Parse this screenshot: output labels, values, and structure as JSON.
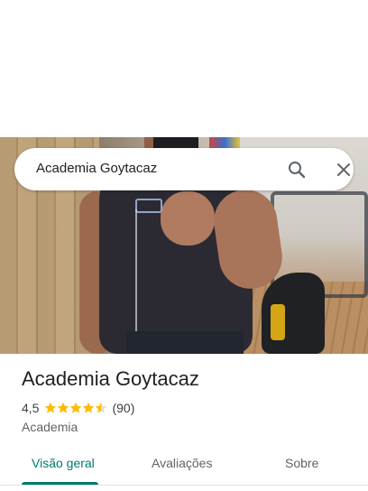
{
  "search": {
    "query": "Academia Goytacaz"
  },
  "place": {
    "name": "Academia Goytacaz",
    "rating_text": "4,5",
    "rating_value": 4.5,
    "rating_max": 5,
    "review_count_text": "(90)",
    "category": "Academia"
  },
  "tabs": [
    {
      "label": "Visão geral",
      "active": true
    },
    {
      "label": "Avaliações",
      "active": false
    },
    {
      "label": "Sobre",
      "active": false
    }
  ],
  "colors": {
    "accent": "#01796f",
    "star": "#fbbc04",
    "text_primary": "#202124",
    "text_secondary": "#5f6368"
  },
  "icons": {
    "search": "search-icon",
    "close": "close-icon",
    "star": "star-icon"
  }
}
